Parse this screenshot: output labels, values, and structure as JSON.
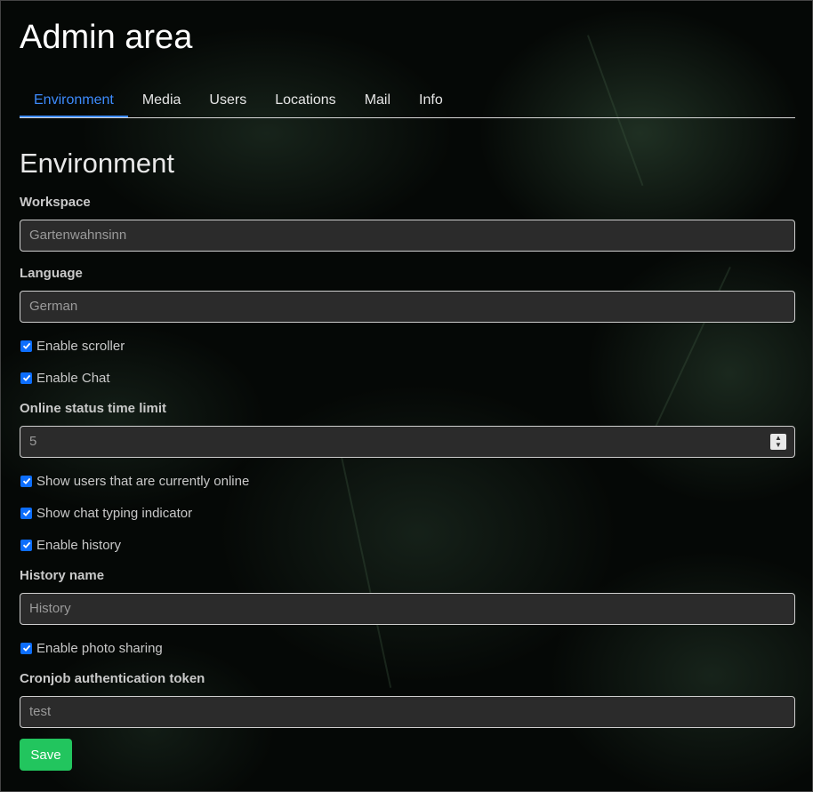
{
  "page": {
    "title": "Admin area"
  },
  "tabs": [
    {
      "label": "Environment",
      "active": true
    },
    {
      "label": "Media"
    },
    {
      "label": "Users"
    },
    {
      "label": "Locations"
    },
    {
      "label": "Mail"
    },
    {
      "label": "Info"
    }
  ],
  "section": {
    "title": "Environment"
  },
  "form": {
    "workspace": {
      "label": "Workspace",
      "value": "Gartenwahnsinn"
    },
    "language": {
      "label": "Language",
      "value": "German"
    },
    "enable_scroller": {
      "label": "Enable scroller",
      "checked": true
    },
    "enable_chat": {
      "label": "Enable Chat",
      "checked": true
    },
    "online_status": {
      "label": "Online status time limit",
      "value": "5"
    },
    "show_online_users": {
      "label": "Show users that are currently online",
      "checked": true
    },
    "show_typing": {
      "label": "Show chat typing indicator",
      "checked": true
    },
    "enable_history": {
      "label": "Enable history",
      "checked": true
    },
    "history_name": {
      "label": "History name",
      "value": "History"
    },
    "enable_photo_sharing": {
      "label": "Enable photo sharing",
      "checked": true
    },
    "cronjob_token": {
      "label": "Cronjob authentication token",
      "value": "test"
    },
    "save_label": "Save"
  },
  "colors": {
    "accent": "#3d8bfd",
    "checkbox": "#0d6efd",
    "save": "#22c55e"
  }
}
